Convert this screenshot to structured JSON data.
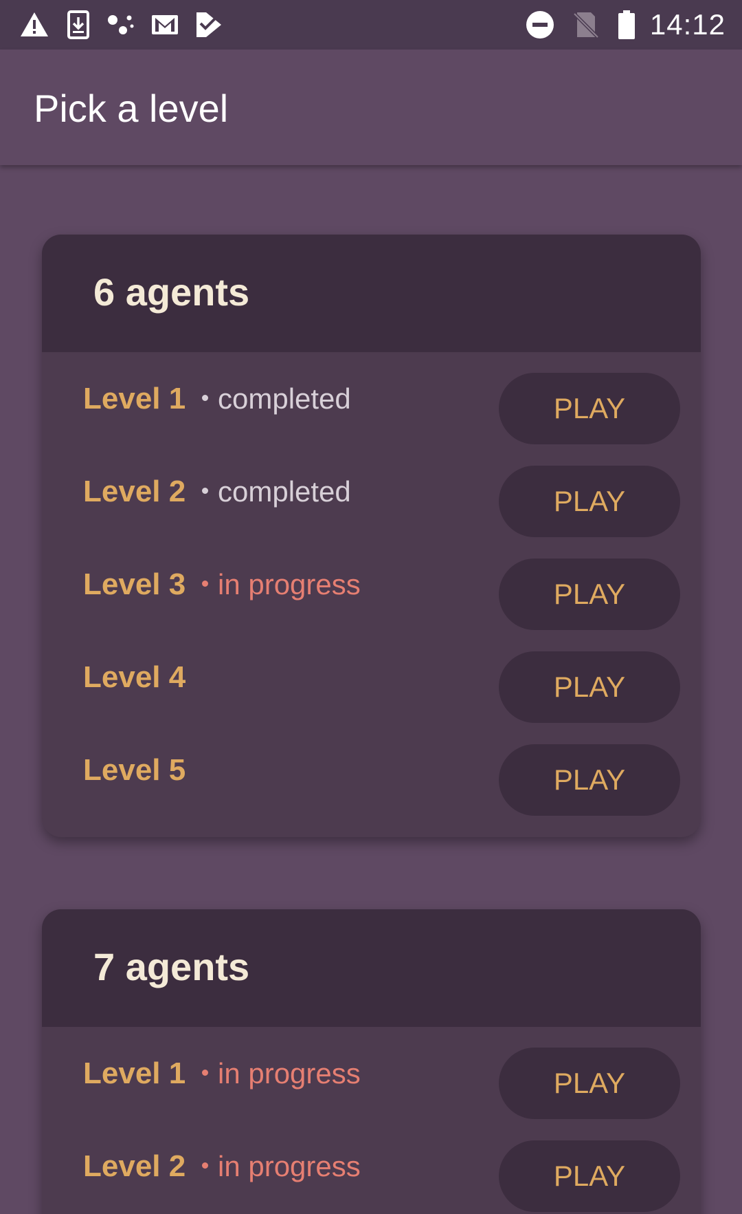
{
  "status_bar": {
    "time": "14:12",
    "left_icons": [
      "warning-icon",
      "download-icon",
      "dots-icon",
      "gmail-icon",
      "feedback-icon"
    ],
    "right_icons": [
      "do-not-disturb-icon",
      "no-sim-icon",
      "battery-icon"
    ]
  },
  "app_bar": {
    "title": "Pick a level"
  },
  "groups": [
    {
      "title": "6 agents",
      "levels": [
        {
          "name": "Level 1",
          "status": "completed",
          "play_label": "PLAY"
        },
        {
          "name": "Level 2",
          "status": "completed",
          "play_label": "PLAY"
        },
        {
          "name": "Level 3",
          "status": "in progress",
          "play_label": "PLAY"
        },
        {
          "name": "Level 4",
          "status": "",
          "play_label": "PLAY"
        },
        {
          "name": "Level 5",
          "status": "",
          "play_label": "PLAY"
        }
      ]
    },
    {
      "title": "7 agents",
      "levels": [
        {
          "name": "Level 1",
          "status": "in progress",
          "play_label": "PLAY"
        },
        {
          "name": "Level 2",
          "status": "in progress",
          "play_label": "PLAY"
        }
      ]
    }
  ],
  "colors": {
    "background": "#5f4963",
    "status_bar": "#4a3a50",
    "card_body": "#4d3b4f",
    "card_header": "#3c2d3f",
    "level_text": "#dfaa60",
    "header_text": "#f4ead7",
    "completed_text": "#d8d0d8",
    "in_progress_text": "#e67f72"
  }
}
